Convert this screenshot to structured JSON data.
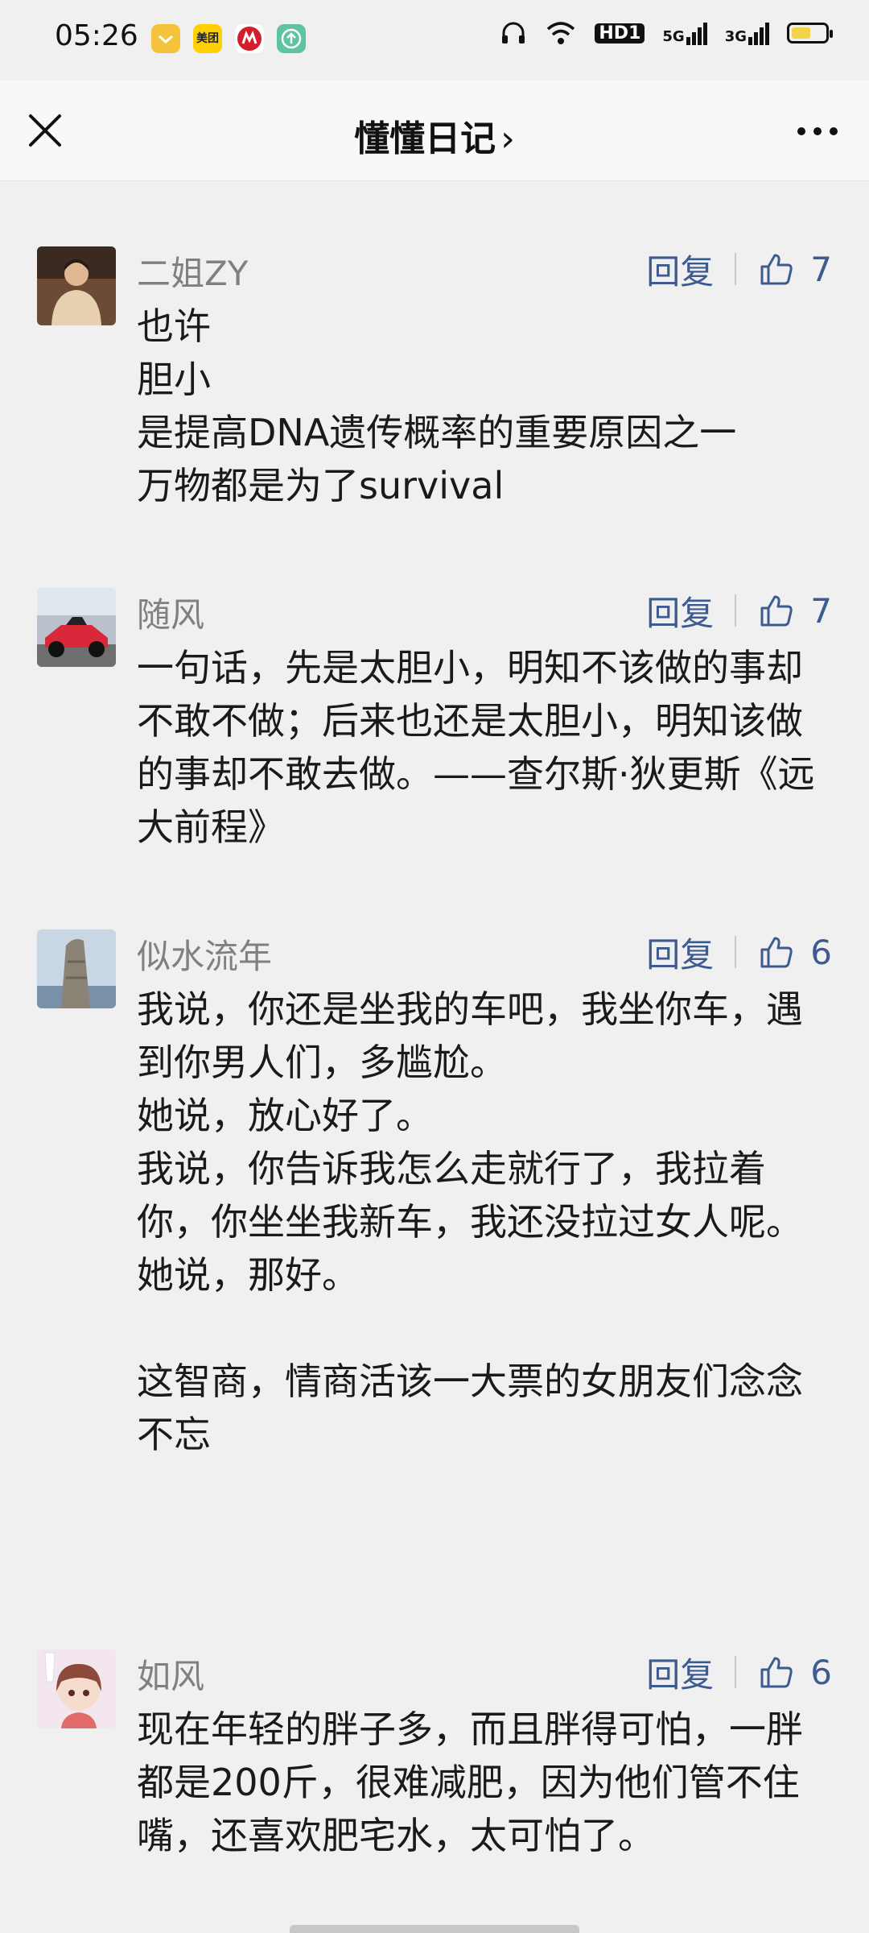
{
  "status_bar": {
    "time": "05:26",
    "app_icons": [
      "notification-app-icon",
      "meituan-icon",
      "cmb-bank-icon",
      "upload-app-icon"
    ],
    "meituan_label": "美团",
    "hd_label": "HD1",
    "net_5g": "5G",
    "net_3g": "3G"
  },
  "nav": {
    "title": "懂懂日记",
    "chevron": "›"
  },
  "comments": [
    {
      "user": "二姐ZY",
      "reply": "回复",
      "likes": "7",
      "text": "也许\n胆小\n是提高DNA遗传概率的重要原因之一\n万物都是为了survival"
    },
    {
      "user": "随风",
      "reply": "回复",
      "likes": "7",
      "text": "一句话，先是太胆小，明知不该做的事却不敢不做；后来也还是太胆小，明知该做的事却不敢去做。——查尔斯·狄更斯《远大前程》"
    },
    {
      "user": "似水流年",
      "reply": "回复",
      "likes": "6",
      "text": "我说，你还是坐我的车吧，我坐你车，遇到你男人们，多尴尬。\n她说，放心好了。\n我说，你告诉我怎么走就行了，我拉着你，你坐坐我新车，我还没拉过女人呢。\n她说，那好。\n\n这智商，情商活该一大票的女朋友们念念不忘"
    },
    {
      "user": "如风",
      "reply": "回复",
      "likes": "6",
      "text": "现在年轻的胖子多，而且胖得可怕，一胖都是200斤，很难减肥，因为他们管不住嘴，还喜欢肥宅水，太可怕了。"
    }
  ]
}
